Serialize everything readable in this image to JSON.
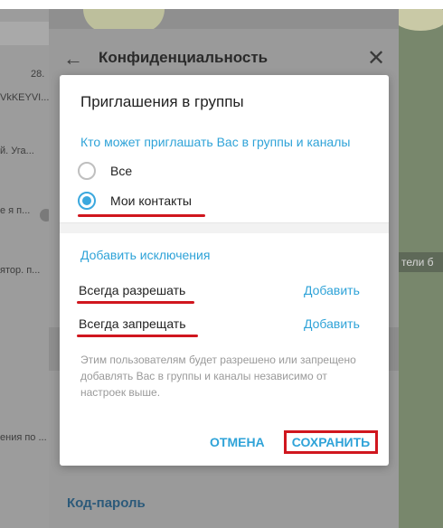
{
  "background": {
    "chat_snippets": [
      "28.",
      "VkKEYVI...",
      "й. Уга...",
      "е я п...",
      "ятор. п...",
      "ения по ..."
    ],
    "pinned_label": "тели б",
    "panel_title": "Конфиденциальность",
    "passcode_label": "Код-пароль"
  },
  "dialog": {
    "title": "Приглашения в группы",
    "who_can_title": "Кто может приглашать Вас в группы и каналы",
    "options": [
      {
        "label": "Все",
        "selected": false
      },
      {
        "label": "Мои контакты",
        "selected": true
      }
    ],
    "exceptions_title": "Добавить исключения",
    "always_allow": "Всегда разрешать",
    "always_deny": "Всегда запрещать",
    "add_label": "Добавить",
    "note": "Этим пользователям будет разрешено или запрещено добавлять Вас в группы и каналы независимо от настроек выше.",
    "cancel": "ОТМЕНА",
    "save": "СОХРАНИТЬ"
  },
  "colors": {
    "accent": "#2fa3d8",
    "annotation_red": "#d0161e"
  }
}
